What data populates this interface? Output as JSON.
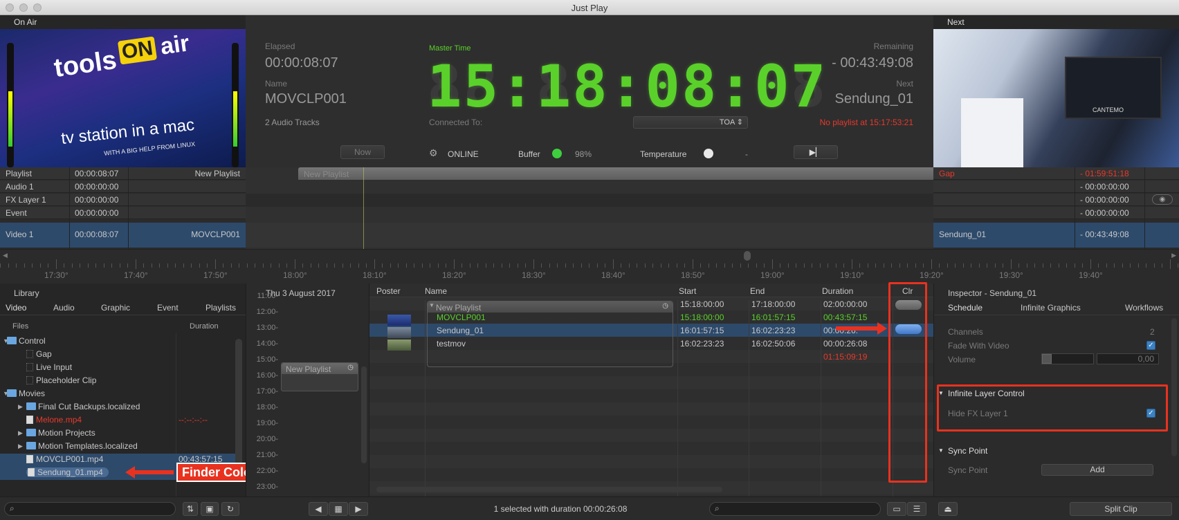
{
  "window": {
    "title": "Just Play"
  },
  "onair": {
    "header": "On Air",
    "preview_text": [
      "tools",
      "ON",
      "air",
      "tv station in a mac",
      "WITH A BIG HELP FROM LINUX"
    ]
  },
  "next": {
    "header": "Next",
    "preview_text": [
      "CANTEMO"
    ]
  },
  "dash": {
    "elapsed_label": "Elapsed",
    "elapsed": "00:00:08:07",
    "name_label": "Name",
    "name": "MOVCLP001",
    "audio_tracks": "2 Audio Tracks",
    "master_label": "Master Time",
    "master_time": "15:18:08:07",
    "master_ghost": "88:88:88:88",
    "connected_label": "Connected To:",
    "toa": "TOA ⇕",
    "remaining_label": "Remaining",
    "remaining": "- 00:43:49:08",
    "next_label": "Next",
    "next_name": "Sendung_01",
    "no_playlist": "No playlist at 15:17:53:21",
    "now_btn": "Now",
    "online": "ONLINE",
    "buffer_label": "Buffer",
    "buffer_val": "98%",
    "temp_label": "Temperature",
    "temp_val": "-",
    "play_icon": "skip-forward-icon"
  },
  "tracks": [
    {
      "name": "Playlist",
      "time": "00:00:08:07",
      "item": "New Playlist"
    },
    {
      "name": "Audio 1",
      "time": "00:00:00:00",
      "item": ""
    },
    {
      "name": "FX Layer 1",
      "time": "00:00:00:00",
      "item": ""
    },
    {
      "name": "Event",
      "time": "00:00:00:00",
      "item": ""
    },
    {
      "name": "Video 1",
      "time": "00:00:08:07",
      "item": "MOVCLP001"
    }
  ],
  "timeline_clip": "New Playlist",
  "next_tracks": [
    {
      "name": "Gap",
      "time": "- 01:59:51:18"
    },
    {
      "name": "",
      "time": "- 00:00:00:00"
    },
    {
      "name": "",
      "time": "- 00:00:00:00"
    },
    {
      "name": "",
      "time": "- 00:00:00:00"
    },
    {
      "name": "Sendung_01",
      "time": "- 00:43:49:08"
    }
  ],
  "ruler": [
    "17:30°",
    "17:40°",
    "17:50°",
    "18:00°",
    "18:10°",
    "18:20°",
    "18:30°",
    "18:40°",
    "18:50°",
    "19:00°",
    "19:10°",
    "19:20°",
    "19:30°",
    "19:40°"
  ],
  "library": {
    "header": "Library",
    "tabs": [
      "Video",
      "Audio",
      "Graphic",
      "Event",
      "Playlists"
    ],
    "col_files": "Files",
    "col_duration": "Duration",
    "items": [
      {
        "label": "Control",
        "kind": "folder",
        "dur": ""
      },
      {
        "label": "Gap",
        "kind": "dots",
        "dur": ""
      },
      {
        "label": "Live Input",
        "kind": "dots",
        "dur": ""
      },
      {
        "label": "Placeholder Clip",
        "kind": "dots",
        "dur": ""
      },
      {
        "label": "Movies",
        "kind": "folder",
        "dur": ""
      },
      {
        "label": "Final Cut Backups.localized",
        "kind": "folder",
        "dur": ""
      },
      {
        "label": "Melone.mp4",
        "kind": "file",
        "dur": "--:--:--:--"
      },
      {
        "label": "Motion Projects",
        "kind": "folder",
        "dur": ""
      },
      {
        "label": "Motion Templates.localized",
        "kind": "folder",
        "dur": ""
      },
      {
        "label": "MOVCLP001.mp4",
        "kind": "file",
        "dur": "00:43:57:15"
      },
      {
        "label": "Sendung_01.mp4",
        "kind": "file",
        "dur": ""
      }
    ],
    "callout": "Finder Color Tag"
  },
  "calendar": {
    "header": "Thu 3 August 2017",
    "hours": [
      "11:00-",
      "12:00-",
      "13:00-",
      "14:00-",
      "15:00-",
      "16:00-",
      "17:00-",
      "18:00-",
      "19:00-",
      "20:00-",
      "21:00-",
      "22:00-",
      "23:00-"
    ],
    "block": "New Playlist"
  },
  "playlist": {
    "cols": [
      "Poster",
      "Name",
      "Start",
      "End",
      "Duration",
      "Clr"
    ],
    "group": "New Playlist",
    "rows": [
      {
        "name": "",
        "start": "15:18:00:00",
        "end": "17:18:00:00",
        "dur": "02:00:00:00"
      },
      {
        "name": "MOVCLP001",
        "start": "15:18:00:00",
        "end": "16:01:57:15",
        "dur": "00:43:57:15"
      },
      {
        "name": "Sendung_01",
        "start": "16:01:57:15",
        "end": "16:02:23:23",
        "dur": "00:00:26:08"
      },
      {
        "name": "testmov",
        "start": "16:02:23:23",
        "end": "16:02:50:06",
        "dur": "00:00:26:08"
      }
    ],
    "overtime": "01:15:09:19"
  },
  "inspector": {
    "header": "Inspector - Sendung_01",
    "tabs": [
      "Schedule",
      "Infinite Graphics",
      "Workflows"
    ],
    "channels_label": "Channels",
    "channels": "2",
    "fade_label": "Fade With Video",
    "volume_label": "Volume",
    "volume": "0,00",
    "ilc_header": "Infinite Layer Control",
    "hide_fx": "Hide FX Layer 1",
    "sync_header": "Sync Point",
    "sync_label": "Sync Point",
    "add_btn": "Add"
  },
  "footer": {
    "status": "1 selected with duration 00:00:26:08",
    "split_clip": "Split Clip"
  },
  "colors": {
    "accent_green": "#5ad12a",
    "alert_red": "#e8321f",
    "selection": "#2d4a6b"
  }
}
